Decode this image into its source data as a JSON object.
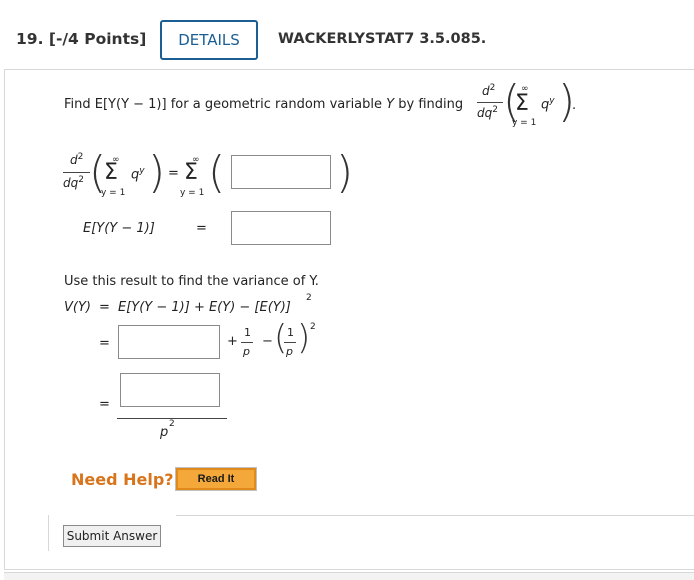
{
  "header": {
    "question_number": "19. [-/4 Points]",
    "details_label": "DETAILS",
    "question_code": "WACKERLYSTAT7 3.5.085."
  },
  "problem": {
    "intro_text_a": "Find E[Y(Y − 1)] for a geometric random variable ",
    "intro_text_var": "Y",
    "intro_text_b": " by finding",
    "d2": "d",
    "two": "2",
    "dq2_d": "dq",
    "sigma": "Σ",
    "infinity": "∞",
    "sum_lower": "y = 1",
    "q": "q",
    "y_exp": "y",
    "period": ".",
    "equals": "=",
    "lparen": "(",
    "rparen": ")",
    "expect_label": "E[Y(Y − 1)]",
    "use_result": "Use this result to find the variance of Y.",
    "variance_lhs": "V(Y)",
    "variance_rhs": "E[Y(Y − 1)] + E(Y) − [E(Y)]",
    "plus": "+",
    "minus": "−",
    "one": "1",
    "p": "p",
    "p2_base": "p"
  },
  "help": {
    "need_help": "Need Help?",
    "read_it": "Read It"
  },
  "submit_label": "Submit Answer"
}
